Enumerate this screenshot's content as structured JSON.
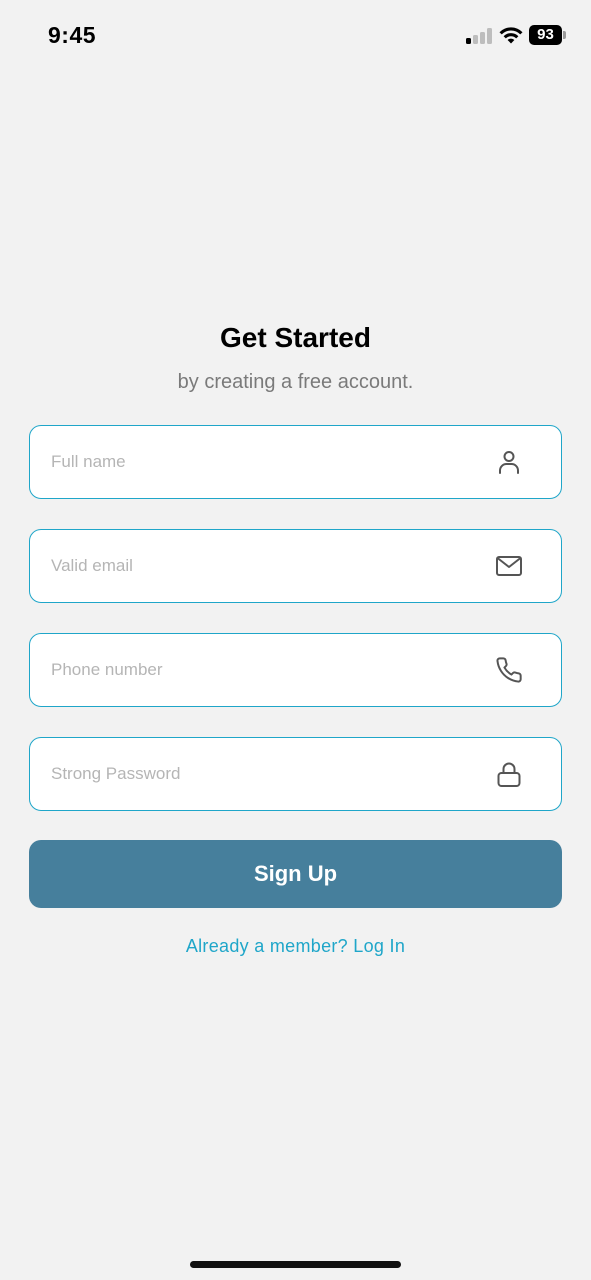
{
  "status_bar": {
    "time": "9:45",
    "battery": "93",
    "signal_bars_active": 1,
    "signal_bars_total": 4
  },
  "header": {
    "title": "Get Started",
    "subtitle": "by creating a free account."
  },
  "form": {
    "fields": [
      {
        "name": "full-name",
        "placeholder": "Full name",
        "value": "",
        "icon": "user-icon"
      },
      {
        "name": "email",
        "placeholder": "Valid email",
        "value": "",
        "icon": "mail-icon"
      },
      {
        "name": "phone",
        "placeholder": "Phone number",
        "value": "",
        "icon": "phone-icon"
      },
      {
        "name": "password",
        "placeholder": "Strong Password",
        "value": "",
        "icon": "lock-icon"
      }
    ],
    "submit_label": "Sign Up",
    "login_link": "Already a member? Log In"
  },
  "colors": {
    "background": "#f2f2f2",
    "field_border": "#1fa6c9",
    "button": "#467f9c",
    "link": "#1fa6c9"
  }
}
